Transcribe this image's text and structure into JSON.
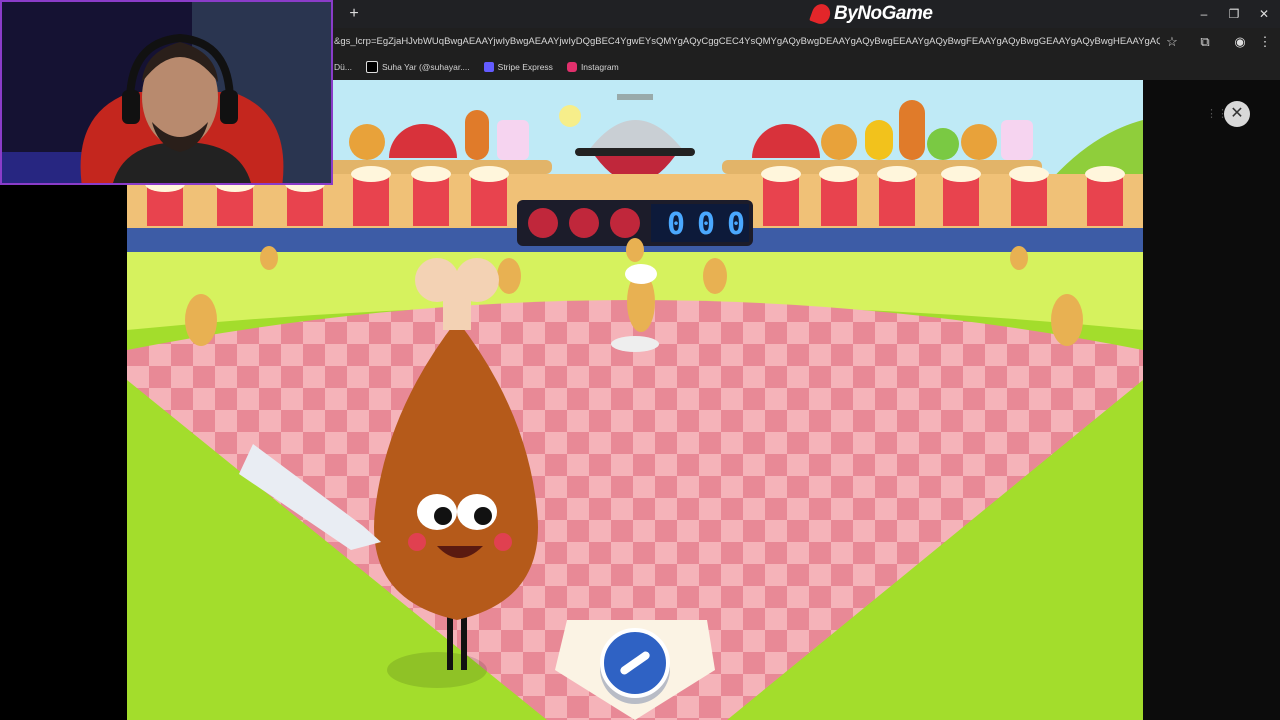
{
  "browser": {
    "brand": "ByNoGame",
    "new_tab": "+",
    "url": "&gs_lcrp=EgZjaHJvbWUqBwgAEAAYjwIyBwgAEAAYjwIyDQgBEC4YgwEYsQMYgAQyCggCEC4YsQMYgAQyBwgDEAAYgAQyBwgEEAAYgAQyBwgFEAAYgAQyBwgGEAAYgAQyBwgHEAAYgAQyBwgIEAAYg...",
    "bookmarks": [
      {
        "label": "Dü...",
        "color": "#5f6368"
      },
      {
        "label": "Suha Yar (@suhayar....",
        "color": "#ffffff"
      },
      {
        "label": "Stripe Express",
        "color": "#635bff"
      },
      {
        "label": "Instagram",
        "color": "#e1306c"
      }
    ],
    "window_controls": [
      "–",
      "❐",
      "✕"
    ],
    "toolbar_icons": [
      "star-icon",
      "extensions-icon",
      "profile-icon",
      "menu-icon"
    ]
  },
  "game": {
    "scoreboard": {
      "balls": 3,
      "score": "000"
    },
    "close_label": "✕",
    "grid_label": "⋮⋮",
    "swing_button_icon": "bat-icon"
  },
  "colors": {
    "sky": "#bfeaf6",
    "field_green": "#a3dd2c",
    "field_light": "#d6f25e",
    "checker_a": "#f3a9b0",
    "checker_b": "#e77f8c",
    "chicken": "#b55a1a",
    "button_blue": "#2f62c4",
    "stream_border": "#8a3cc9"
  }
}
